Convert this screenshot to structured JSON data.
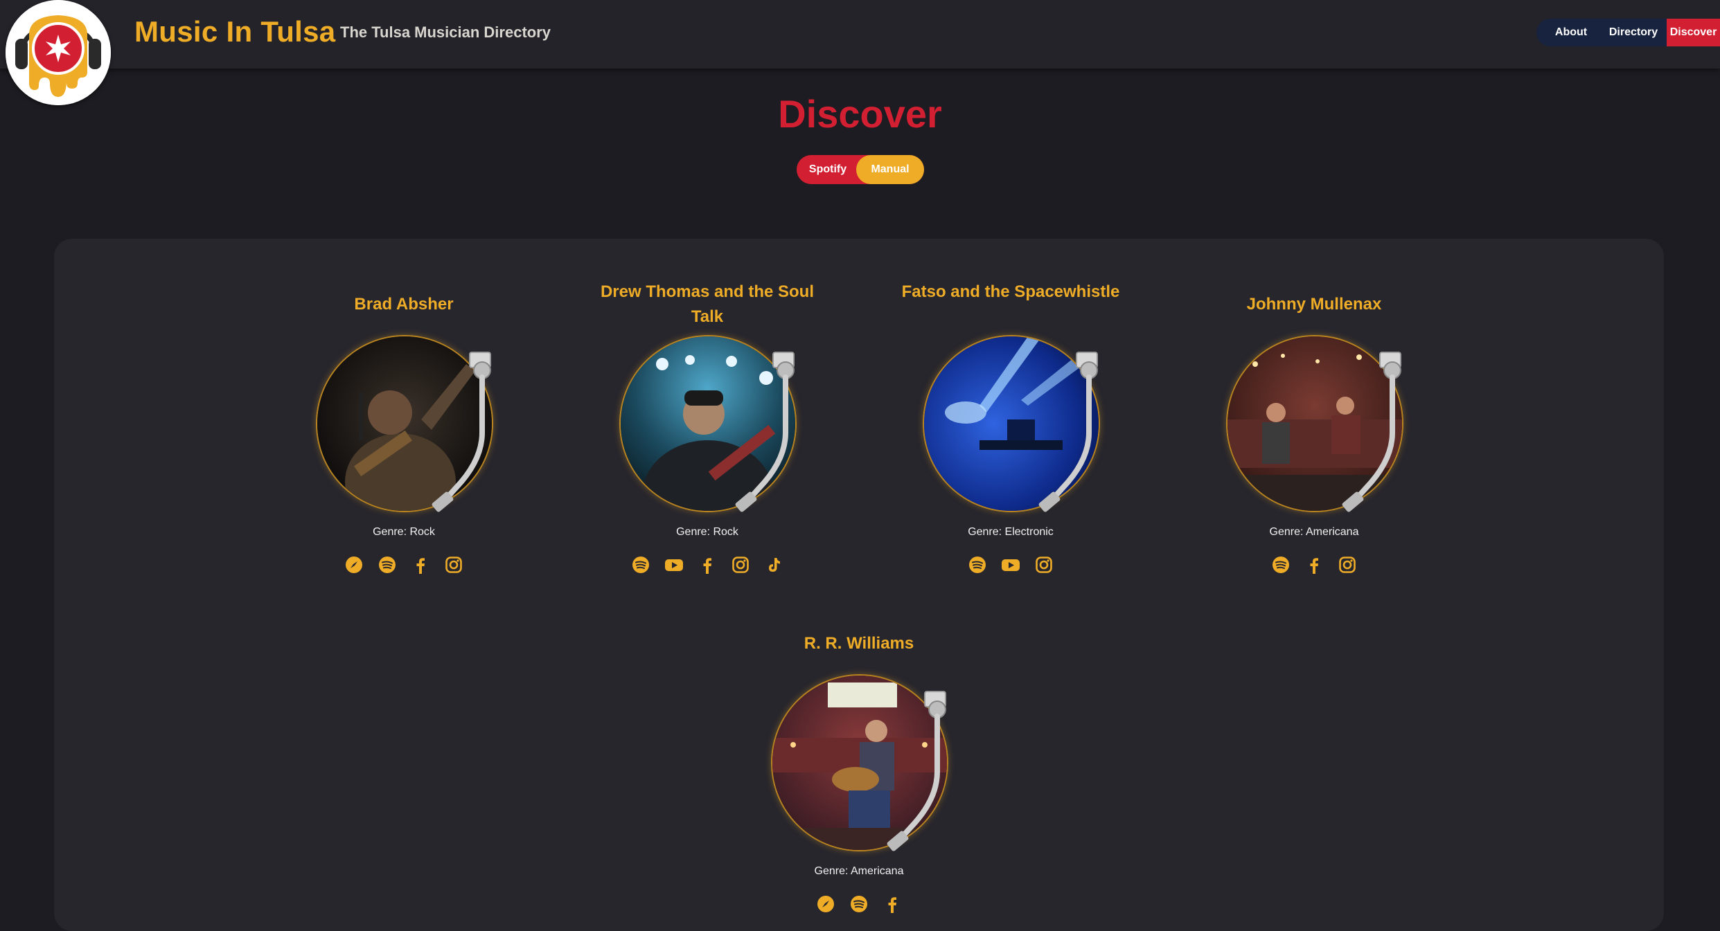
{
  "header": {
    "title": "Music In Tulsa",
    "subtitle": "The Tulsa Musician Directory",
    "nav": {
      "about": "About",
      "directory": "Directory",
      "discover": "Discover"
    }
  },
  "page": {
    "title": "Discover",
    "toggle": {
      "spotify": "Spotify",
      "manual": "Manual",
      "active": "Manual"
    }
  },
  "colors": {
    "brand_red": "#d21f32",
    "brand_gold": "#eeac27",
    "nav_bg": "#17233f",
    "background": "#1d1c22",
    "panel": "#27262d"
  },
  "artists": [
    {
      "name": "Brad Absher",
      "genre": "Genre: Rock",
      "socials": [
        "compass-icon",
        "spotify-icon",
        "facebook-icon",
        "instagram-icon"
      ]
    },
    {
      "name": "Drew Thomas and the Soul Talk",
      "genre": "Genre: Rock",
      "socials": [
        "spotify-icon",
        "youtube-icon",
        "facebook-icon",
        "instagram-icon",
        "tiktok-icon"
      ]
    },
    {
      "name": "Fatso and the Spacewhistle",
      "genre": "Genre: Electronic",
      "socials": [
        "spotify-icon",
        "youtube-icon",
        "instagram-icon"
      ]
    },
    {
      "name": "Johnny Mullenax",
      "genre": "Genre: Americana",
      "socials": [
        "spotify-icon",
        "facebook-icon",
        "instagram-icon"
      ]
    },
    {
      "name": "R. R. Williams",
      "genre": "Genre: Americana",
      "socials": [
        "compass-icon",
        "spotify-icon",
        "facebook-icon"
      ]
    }
  ]
}
